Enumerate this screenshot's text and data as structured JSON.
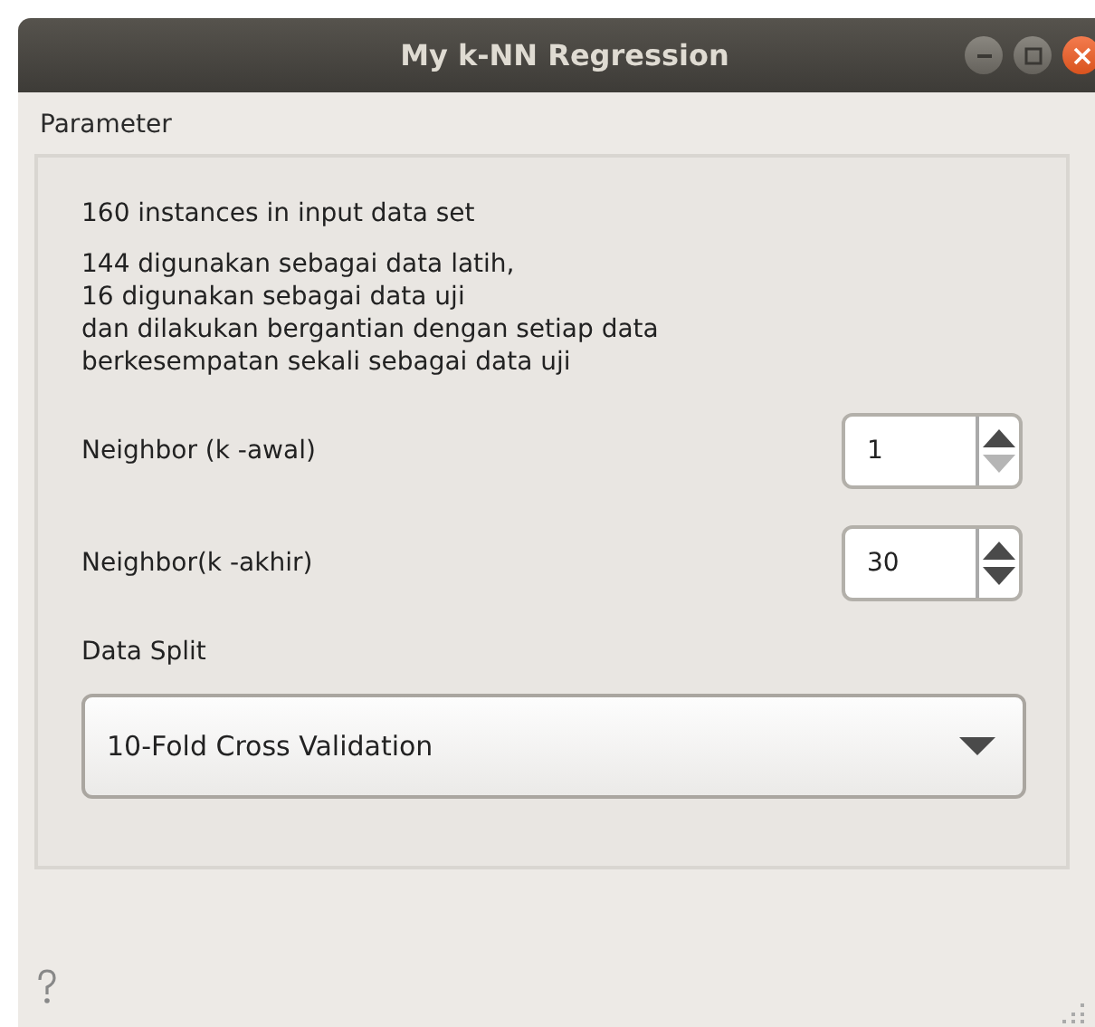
{
  "window": {
    "title": "My k-NN Regression"
  },
  "group": {
    "title": "Parameter",
    "info": "160 instances in input data set",
    "description": [
      "144 digunakan sebagai data latih,",
      "16 digunakan sebagai data uji",
      "dan dilakukan bergantian dengan setiap data",
      "berkesempatan sekali sebagai data uji"
    ],
    "spinboxes": [
      {
        "label": "Neighbor (k -awal)",
        "value": "1",
        "down_disabled": true
      },
      {
        "label": "Neighbor(k -akhir)",
        "value": "30",
        "down_disabled": false
      }
    ],
    "split_label": "Data Split",
    "split_value": "10-Fold Cross Validation"
  }
}
